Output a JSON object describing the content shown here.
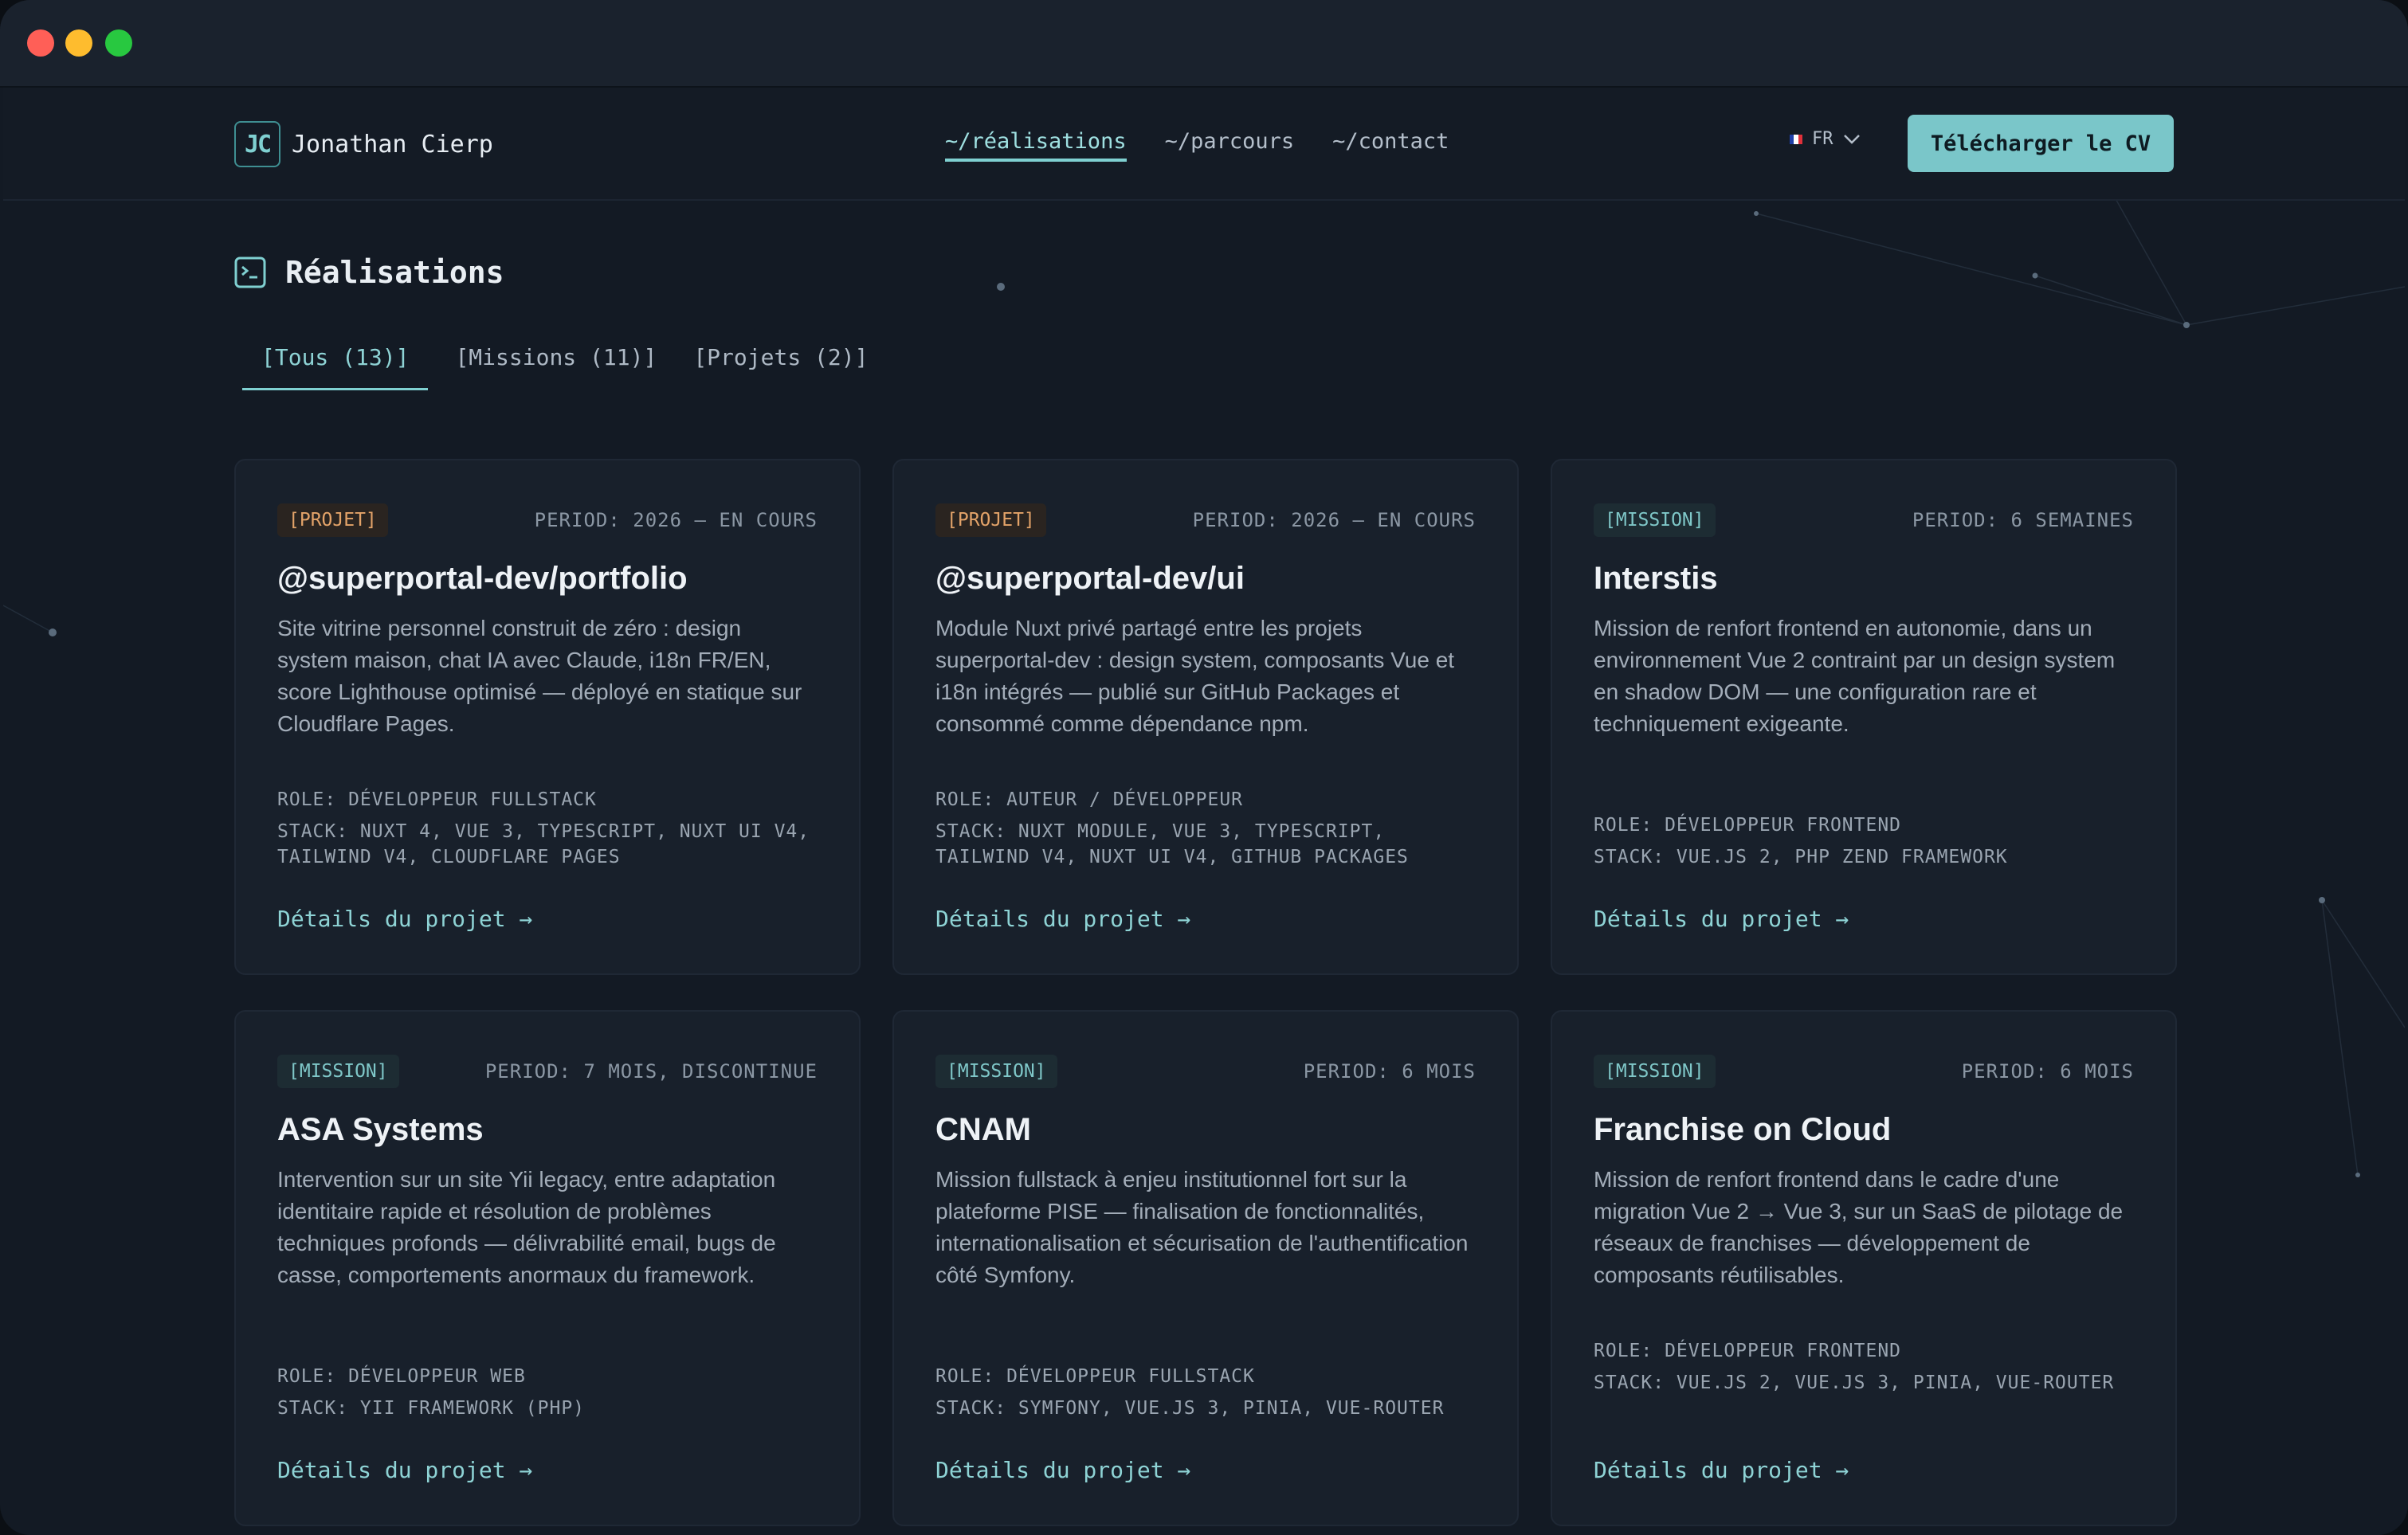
{
  "brand": {
    "logo": "JC",
    "name": "Jonathan Cierp"
  },
  "nav": {
    "links": [
      {
        "label": "~/réalisations",
        "active": true
      },
      {
        "label": "~/parcours",
        "active": false
      },
      {
        "label": "~/contact",
        "active": false
      }
    ],
    "language": {
      "code": "FR",
      "flag_colors": [
        "#1f3fa8",
        "#ffffff",
        "#e0303a"
      ]
    },
    "cta_label": "Télécharger le CV"
  },
  "section": {
    "icon": "terminal-icon",
    "title": "Réalisations"
  },
  "tabs": [
    {
      "label": "[Tous (13)]",
      "active": true
    },
    {
      "label": "[Missions (11)]",
      "active": false
    },
    {
      "label": "[Projets (2)]",
      "active": false
    }
  ],
  "cards": [
    {
      "badge": "[PROJET]",
      "kind": "projet",
      "period": "PERIOD: 2026 — EN COURS",
      "title": "@superportal-dev/portfolio",
      "description": "Site vitrine personnel construit de zéro : design system maison, chat IA avec Claude, i18n FR/EN, score Lighthouse optimisé — déployé en statique sur Cloudflare Pages.",
      "role": "ROLE: DÉVELOPPEUR FULLSTACK",
      "stack": "STACK: NUXT 4, VUE 3, TYPESCRIPT, NUXT UI V4, TAILWIND V4, CLOUDFLARE PAGES",
      "link": "Détails du projet →"
    },
    {
      "badge": "[PROJET]",
      "kind": "projet",
      "period": "PERIOD: 2026 — EN COURS",
      "title": "@superportal-dev/ui",
      "description": "Module Nuxt privé partagé entre les projets superportal-dev : design system, composants Vue et i18n intégrés — publié sur GitHub Packages et consommé comme dépendance npm.",
      "role": "ROLE: AUTEUR / DÉVELOPPEUR",
      "stack": "STACK: NUXT MODULE, VUE 3, TYPESCRIPT, TAILWIND V4, NUXT UI V4, GITHUB PACKAGES",
      "link": "Détails du projet →"
    },
    {
      "badge": "[MISSION]",
      "kind": "mission",
      "period": "PERIOD: 6 SEMAINES",
      "title": "Interstis",
      "description": "Mission de renfort frontend en autonomie, dans un environnement Vue 2 contraint par un design system en shadow DOM — une configuration rare et techniquement exigeante.",
      "role": "ROLE: DÉVELOPPEUR FRONTEND",
      "stack": "STACK: VUE.JS 2, PHP ZEND FRAMEWORK",
      "link": "Détails du projet →"
    },
    {
      "badge": "[MISSION]",
      "kind": "mission",
      "period": "PERIOD: 7 MOIS, DISCONTINUE",
      "title": "ASA Systems",
      "description": "Intervention sur un site Yii legacy, entre adaptation identitaire rapide et résolution de problèmes techniques profonds — délivrabilité email, bugs de casse, comportements anormaux du framework.",
      "role": "ROLE: DÉVELOPPEUR WEB",
      "stack": "STACK: YII FRAMEWORK (PHP)",
      "link": "Détails du projet →"
    },
    {
      "badge": "[MISSION]",
      "kind": "mission",
      "period": "PERIOD: 6 MOIS",
      "title": "CNAM",
      "description": "Mission fullstack à enjeu institutionnel fort sur la plateforme PISE — finalisation de fonctionnalités, internationalisation et sécurisation de l'authentification côté Symfony.",
      "role": "ROLE: DÉVELOPPEUR FULLSTACK",
      "stack": "STACK: SYMFONY, VUE.JS 3, PINIA, VUE-ROUTER",
      "link": "Détails du projet →"
    },
    {
      "badge": "[MISSION]",
      "kind": "mission",
      "period": "PERIOD: 6 MOIS",
      "title": "Franchise on Cloud",
      "description": "Mission de renfort frontend dans le cadre d'une migration Vue 2 → Vue 3, sur un SaaS de pilotage de réseaux de franchises — développement de composants réutilisables.",
      "role": "ROLE: DÉVELOPPEUR FRONTEND",
      "stack": "STACK: VUE.JS 2, VUE.JS 3, PINIA, VUE-ROUTER",
      "link": "Détails du projet →"
    }
  ]
}
